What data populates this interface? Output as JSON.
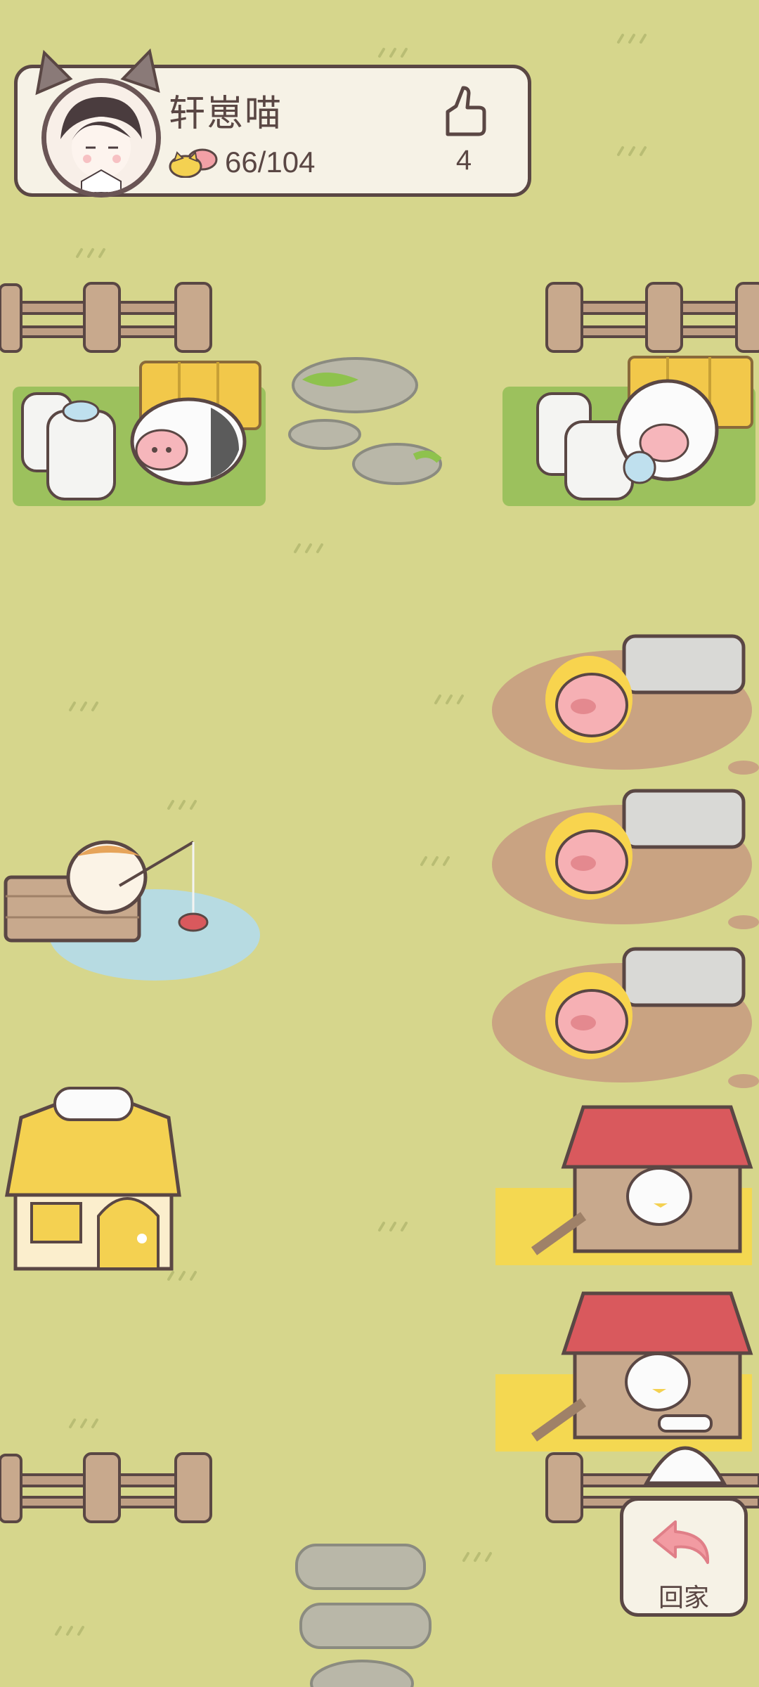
{
  "profile": {
    "name": "轩崽喵",
    "coins": "66/104",
    "likes": "4"
  },
  "home_button": {
    "label": "回家"
  },
  "colors": {
    "grass": "#d6d68c",
    "outline": "#5a4744",
    "card_bg": "#f6f2e6",
    "mud": "#c9a382",
    "roof_red": "#d9595d",
    "roof_yellow": "#f4d151"
  }
}
